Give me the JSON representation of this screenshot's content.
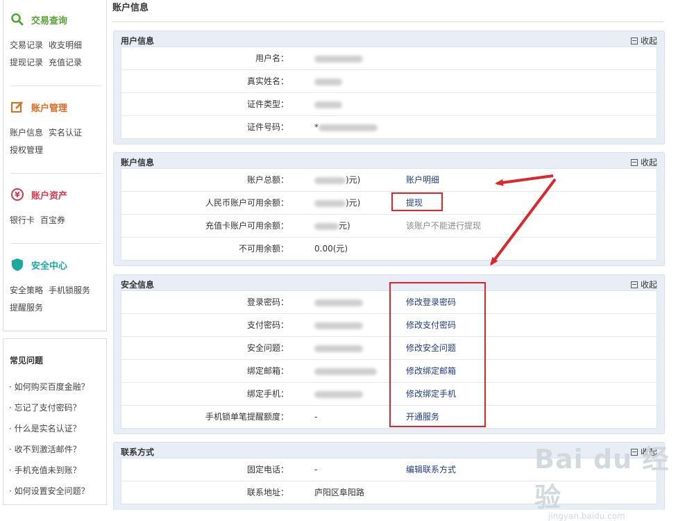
{
  "sidebar": {
    "sections": [
      {
        "title": "交易查询",
        "color": "#55a532",
        "icon": "search-icon",
        "links": [
          [
            "交易记录",
            "收支明细"
          ],
          [
            "提现记录",
            "充值记录"
          ]
        ]
      },
      {
        "title": "账户管理",
        "color": "#e3691d",
        "icon": "edit-icon",
        "links": [
          [
            "账户信息",
            "实名认证"
          ],
          [
            "授权管理"
          ]
        ]
      },
      {
        "title": "账户资产",
        "color": "#d6374b",
        "icon": "yuan-icon",
        "links": [
          [
            "银行卡",
            "百宝券"
          ]
        ]
      },
      {
        "title": "安全中心",
        "color": "#19a9a1",
        "icon": "shield-icon",
        "links": [
          [
            "安全策略",
            "手机锁服务"
          ],
          [
            "提醒服务"
          ]
        ]
      }
    ]
  },
  "faq": {
    "title": "常见问题",
    "items": [
      "· 如何购买百度金融？",
      "· 忘记了支付密码？",
      "· 什么是实名认证？",
      "· 收不到激活邮件？",
      "· 手机充值未到账？",
      "· 如何设置安全问题？"
    ]
  },
  "main": {
    "title": "账户信息",
    "collapse_label": "收起",
    "panels": {
      "user": {
        "title": "用户信息",
        "rows": [
          {
            "label": "用户名："
          },
          {
            "label": "真实姓名："
          },
          {
            "label": "证件类型："
          },
          {
            "label": "证件号码：",
            "value_prefix": "*"
          }
        ]
      },
      "account": {
        "title": "账户信息",
        "rows": [
          {
            "label": "账户总额：",
            "value_suffix": ")元)",
            "action": "账户明细"
          },
          {
            "label": "人民币账户可用余额：",
            "value_suffix": ")元)",
            "action": "提现"
          },
          {
            "label": "充值卡账户可用余额：",
            "value_suffix": "元)",
            "action": "该账户不能进行提现"
          },
          {
            "label": "不可用余额：",
            "value": "0.00(元)"
          }
        ]
      },
      "security": {
        "title": "安全信息",
        "rows": [
          {
            "label": "登录密码：",
            "action": "修改登录密码"
          },
          {
            "label": "支付密码：",
            "action": "修改支付密码"
          },
          {
            "label": "安全问题：",
            "action": "修改安全问题"
          },
          {
            "label": "绑定邮箱：",
            "action": "修改绑定邮箱"
          },
          {
            "label": "绑定手机：",
            "action": "修改绑定手机"
          },
          {
            "label": "手机锁单笔提醒额度：",
            "value": "-",
            "action": "开通服务"
          }
        ]
      },
      "contact": {
        "title": "联系方式",
        "rows": [
          {
            "label": "固定电话：",
            "value": "-",
            "action": "编辑联系方式"
          },
          {
            "label": "联系地址：",
            "value": "庐阳区阜阳路"
          }
        ]
      }
    }
  },
  "annotation_color": "#e0242a",
  "watermark": {
    "logo": "Bai du 经验",
    "url": "jingyan.baidu.com"
  }
}
